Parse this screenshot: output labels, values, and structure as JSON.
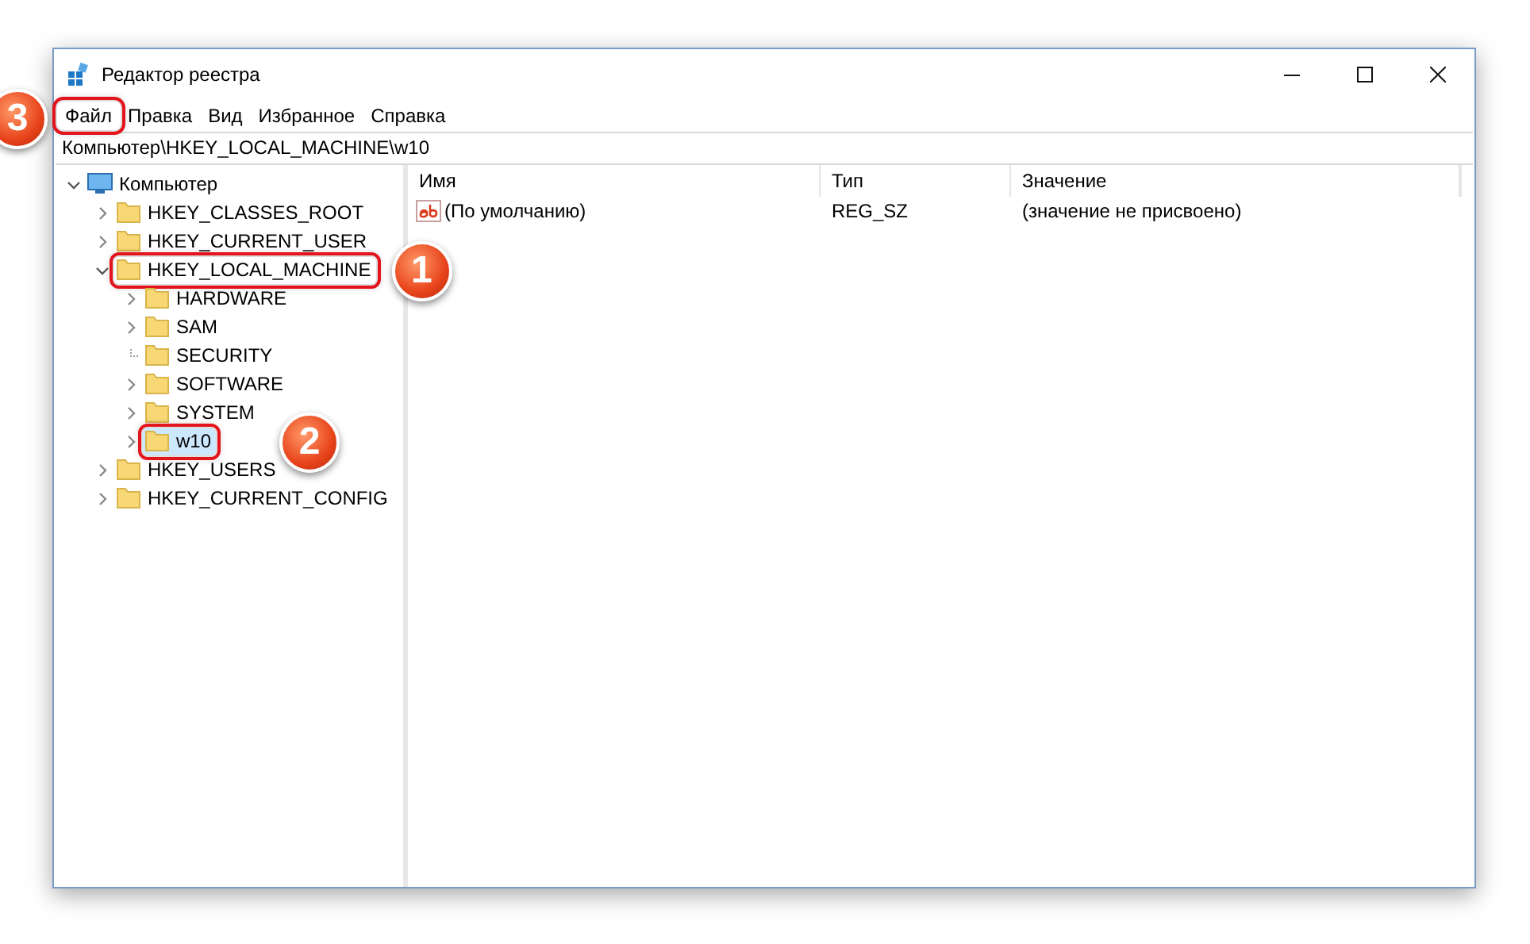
{
  "window": {
    "title": "Редактор реестра"
  },
  "menu": [
    {
      "label": "Файл",
      "callout": "3"
    },
    {
      "label": "Правка"
    },
    {
      "label": "Вид"
    },
    {
      "label": "Избранное"
    },
    {
      "label": "Справка"
    }
  ],
  "address": "Компьютер\\HKEY_LOCAL_MACHINE\\w10",
  "tree": [
    {
      "label": "Компьютер",
      "kind": "computer",
      "expandable": true,
      "expanded": true,
      "selected": false,
      "children": [
        {
          "label": "HKEY_CLASSES_ROOT",
          "kind": "folder",
          "expandable": true,
          "expanded": false,
          "selected": false
        },
        {
          "label": "HKEY_CURRENT_USER",
          "kind": "folder",
          "expandable": true,
          "expanded": false,
          "selected": false
        },
        {
          "label": "HKEY_LOCAL_MACHINE",
          "kind": "folder",
          "expandable": true,
          "expanded": true,
          "selected": false,
          "callout": "1",
          "children": [
            {
              "label": "HARDWARE",
              "kind": "folder",
              "expandable": true,
              "expanded": false,
              "selected": false
            },
            {
              "label": "SAM",
              "kind": "folder",
              "expandable": true,
              "expanded": false,
              "selected": false
            },
            {
              "label": "SECURITY",
              "kind": "folder",
              "expandable": false,
              "expanded": false,
              "selected": false
            },
            {
              "label": "SOFTWARE",
              "kind": "folder",
              "expandable": true,
              "expanded": false,
              "selected": false
            },
            {
              "label": "SYSTEM",
              "kind": "folder",
              "expandable": true,
              "expanded": false,
              "selected": false
            },
            {
              "label": "w10",
              "kind": "folder",
              "expandable": true,
              "expanded": false,
              "selected": true,
              "callout": "2"
            }
          ]
        },
        {
          "label": "HKEY_USERS",
          "kind": "folder",
          "expandable": true,
          "expanded": false,
          "selected": false
        },
        {
          "label": "HKEY_CURRENT_CONFIG",
          "kind": "folder",
          "expandable": true,
          "expanded": false,
          "selected": false
        }
      ]
    }
  ],
  "table": {
    "columns": [
      "Имя",
      "Тип",
      "Значение"
    ],
    "rows": [
      {
        "name": "(По умолчанию)",
        "type": "REG_SZ",
        "value": "(значение не присвоено)",
        "kind": "string"
      }
    ]
  }
}
